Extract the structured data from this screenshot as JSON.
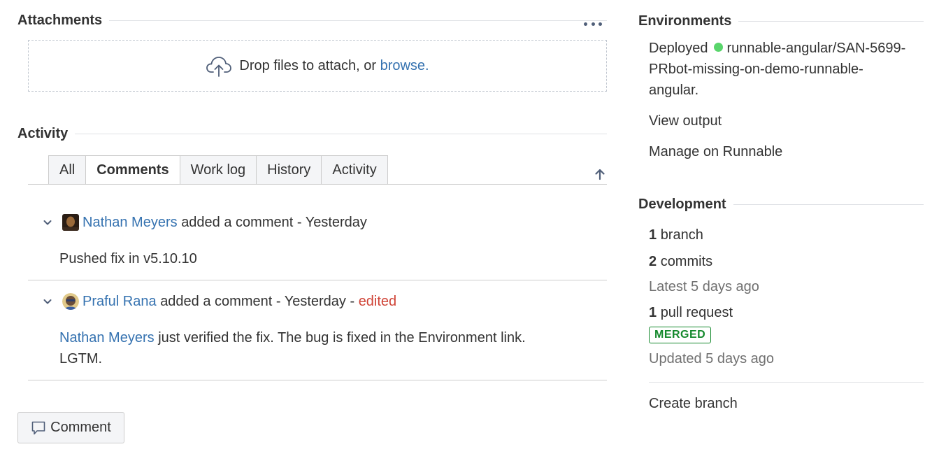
{
  "attachments": {
    "title": "Attachments",
    "more_icon": "ellipsis-icon",
    "drop_text": "Drop files to attach, or ",
    "browse_link": "browse.",
    "upload_icon": "cloud-upload-icon"
  },
  "activity": {
    "title": "Activity",
    "tabs": [
      "All",
      "Comments",
      "Work log",
      "History",
      "Activity"
    ],
    "active_tab": "Comments",
    "sort_icon": "arrow-up-icon",
    "comments": [
      {
        "author": "Nathan Meyers",
        "action": "added a comment - Yesterday",
        "edited": "",
        "body_text": "Pushed fix in v5.10.10"
      },
      {
        "author": "Praful Rana",
        "action": "added a comment - Yesterday - ",
        "edited": "edited",
        "body_mention": "Nathan Meyers",
        "body_text": "just verified the fix. The bug is fixed in the Environment link.",
        "body_text2": "LGTM."
      }
    ],
    "comment_button": "Comment"
  },
  "environments": {
    "title": "Environments",
    "status_label": "Deployed",
    "status_color": "#59d56b",
    "deploy_line1": "runnable-angular/SAN-5699-",
    "deploy_line2": "PRbot-missing-on-demo-runnable-",
    "deploy_line3": "angular.",
    "view_output": "View output",
    "manage": "Manage on Runnable"
  },
  "development": {
    "title": "Development",
    "branch_count": "1",
    "branch_label": "branch",
    "commit_count": "2",
    "commit_label": "commits",
    "latest": "Latest 5 days ago",
    "pr_count": "1",
    "pr_label": "pull request",
    "pr_status": "MERGED",
    "updated": "Updated 5 days ago",
    "create_branch": "Create branch"
  }
}
